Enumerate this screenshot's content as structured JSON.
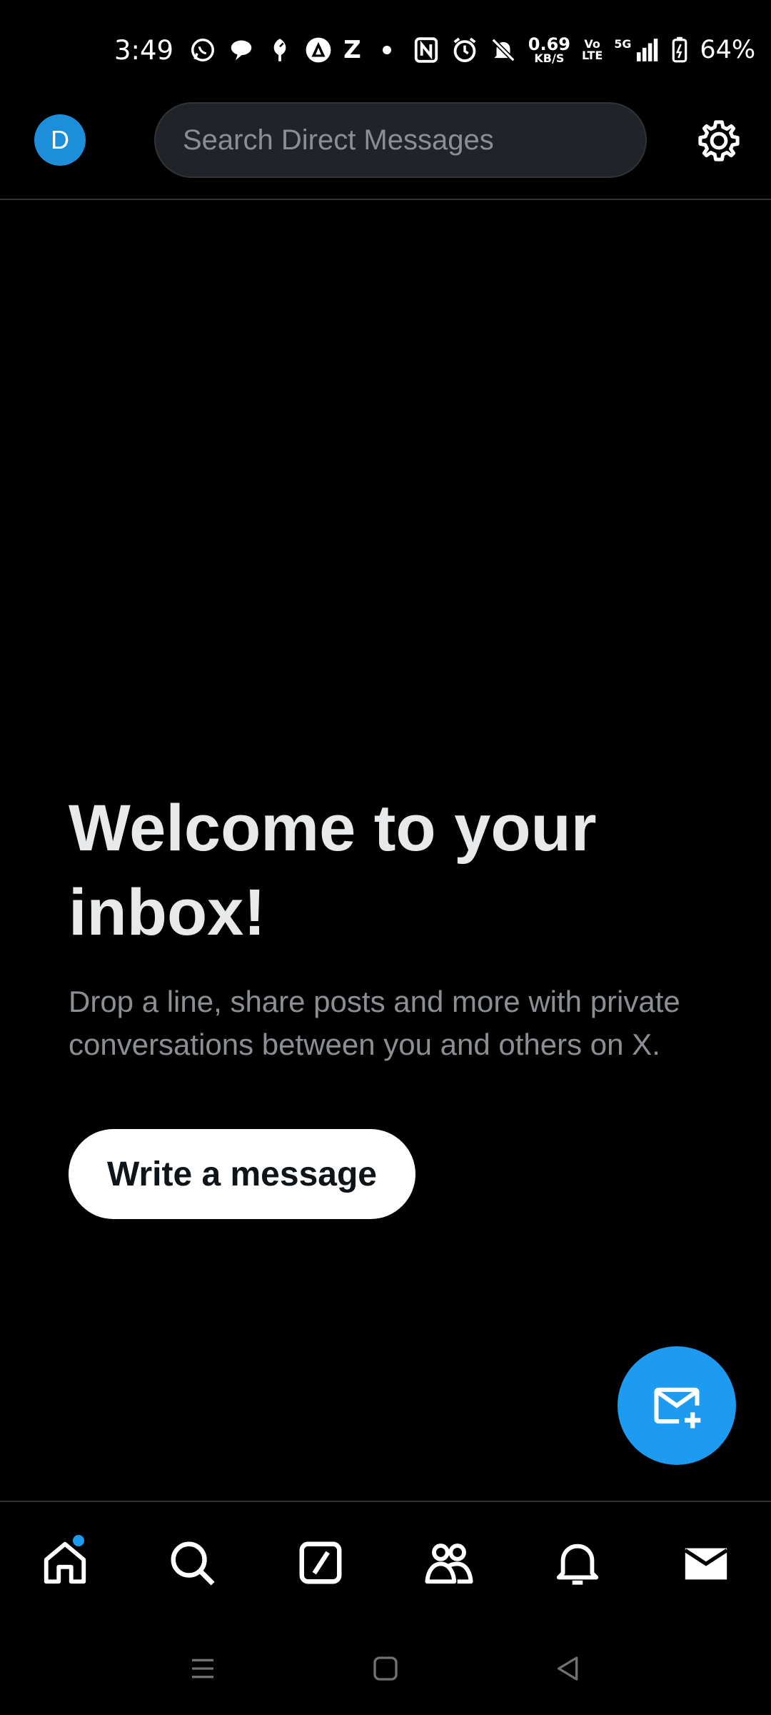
{
  "status_bar": {
    "time": "3:49",
    "speed_value": "0.69",
    "speed_unit": "KB/S",
    "volte_top": "Vo",
    "volte_bottom": "LTE",
    "network": "5G",
    "battery_percent": "64%",
    "icons": [
      "whatsapp-icon",
      "chat-bubble-icon",
      "leaf-icon",
      "triangle-app-icon",
      "z-app-icon",
      "dot-icon",
      "nfc-icon",
      "alarm-icon",
      "mute-bell-icon",
      "signal-icon",
      "battery-icon"
    ]
  },
  "header": {
    "avatar_letter": "D",
    "search_placeholder": "Search Direct Messages",
    "settings_icon": "gear-icon"
  },
  "empty_state": {
    "title": "Welcome to your inbox!",
    "body": "Drop a line, share posts and more with private conversations between you and others on X.",
    "button_label": "Write a message"
  },
  "fab": {
    "icon": "new-message-icon"
  },
  "bottom_nav": {
    "items": [
      {
        "name": "home",
        "icon": "home-icon",
        "has_notification": true
      },
      {
        "name": "search",
        "icon": "search-icon"
      },
      {
        "name": "grok",
        "icon": "grok-icon"
      },
      {
        "name": "communities",
        "icon": "people-icon"
      },
      {
        "name": "notifications",
        "icon": "bell-icon"
      },
      {
        "name": "messages",
        "icon": "envelope-icon",
        "active": true
      }
    ]
  },
  "colors": {
    "accent": "#1d9bf0",
    "background": "#000000",
    "muted_text": "#8b8f94",
    "avatar": "#1d8ed9"
  }
}
